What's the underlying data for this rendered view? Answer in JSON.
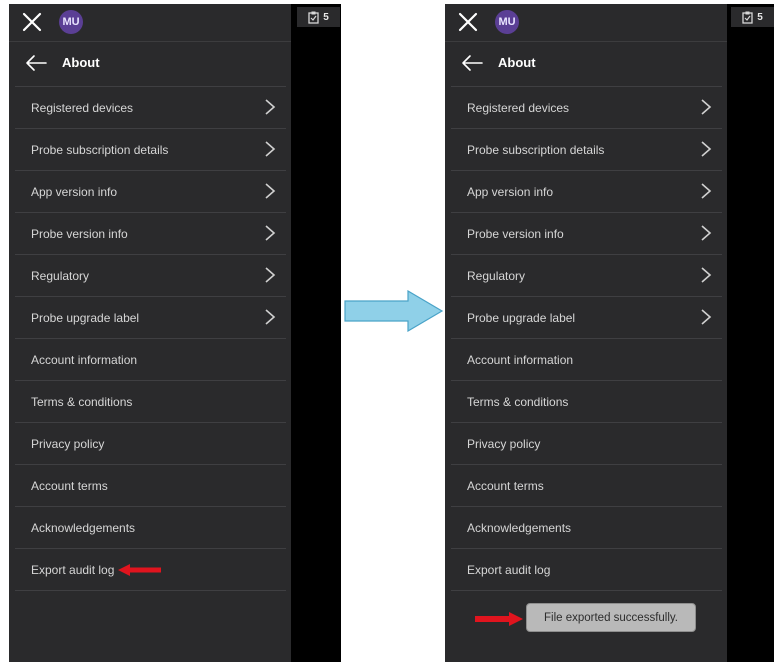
{
  "screens": [
    {
      "avatar_initials": "MU",
      "notification_count": "5",
      "header_title": "About",
      "menu_items": [
        {
          "label": "Registered devices",
          "chevron": true
        },
        {
          "label": "Probe subscription details",
          "chevron": true
        },
        {
          "label": "App version info",
          "chevron": true
        },
        {
          "label": "Probe version info",
          "chevron": true
        },
        {
          "label": "Regulatory",
          "chevron": true
        },
        {
          "label": "Probe upgrade label",
          "chevron": true
        },
        {
          "label": "Account information",
          "chevron": false
        },
        {
          "label": "Terms & conditions",
          "chevron": false
        },
        {
          "label": "Privacy policy",
          "chevron": false
        },
        {
          "label": "Account terms",
          "chevron": false
        },
        {
          "label": "Acknowledgements",
          "chevron": false
        },
        {
          "label": "Export audit log",
          "chevron": false
        }
      ]
    },
    {
      "avatar_initials": "MU",
      "notification_count": "5",
      "header_title": "About",
      "menu_items": [
        {
          "label": "Registered devices",
          "chevron": true
        },
        {
          "label": "Probe subscription details",
          "chevron": true
        },
        {
          "label": "App version info",
          "chevron": true
        },
        {
          "label": "Probe version info",
          "chevron": true
        },
        {
          "label": "Regulatory",
          "chevron": true
        },
        {
          "label": "Probe upgrade label",
          "chevron": true
        },
        {
          "label": "Account information",
          "chevron": false
        },
        {
          "label": "Terms & conditions",
          "chevron": false
        },
        {
          "label": "Privacy policy",
          "chevron": false
        },
        {
          "label": "Account terms",
          "chevron": false
        },
        {
          "label": "Acknowledgements",
          "chevron": false
        },
        {
          "label": "Export audit log",
          "chevron": false
        }
      ],
      "toast": "File exported successfully."
    }
  ],
  "colors": {
    "background": "#2a2a2c",
    "avatar": "#5b3f95",
    "callout_arrow": "#e0141e",
    "transition_arrow": "#8fd0e8"
  },
  "icons": [
    "close-icon",
    "back-arrow-icon",
    "chevron-right-icon",
    "clipboard-icon",
    "red-arrow-icon",
    "transition-arrow-icon"
  ]
}
